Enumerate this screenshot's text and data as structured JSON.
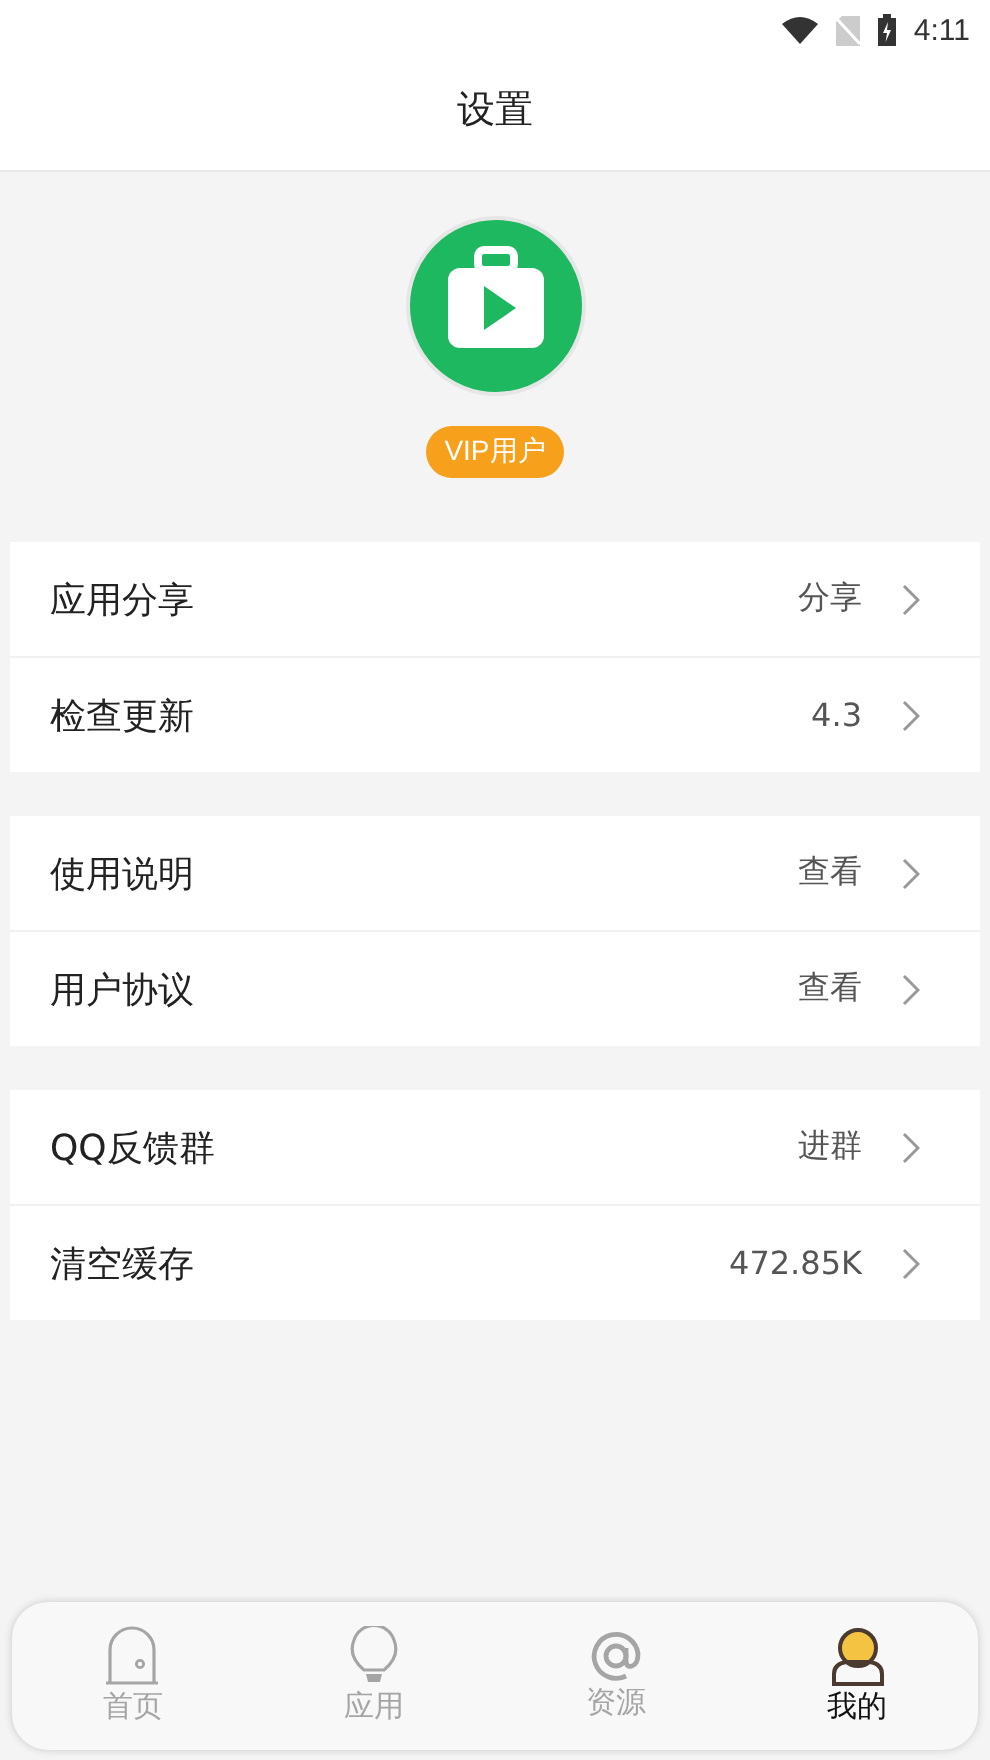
{
  "status_bar": {
    "time": "4:11"
  },
  "header": {
    "title": "设置"
  },
  "profile": {
    "badge": "VIP用户"
  },
  "groups": [
    {
      "rows": [
        {
          "label": "应用分享",
          "value": "分享"
        },
        {
          "label": "检查更新",
          "value": "4.3"
        }
      ]
    },
    {
      "rows": [
        {
          "label": "使用说明",
          "value": "查看"
        },
        {
          "label": "用户协议",
          "value": "查看"
        }
      ]
    },
    {
      "rows": [
        {
          "label": "QQ反馈群",
          "value": "进群"
        },
        {
          "label": "清空缓存",
          "value": "472.85K"
        }
      ]
    }
  ],
  "tab_bar": [
    {
      "kind": "home",
      "label": "首页",
      "selected": false
    },
    {
      "kind": "apps",
      "label": "应用",
      "selected": false
    },
    {
      "kind": "resources",
      "label": "资源",
      "selected": false
    },
    {
      "kind": "me",
      "label": "我的",
      "selected": true
    }
  ]
}
